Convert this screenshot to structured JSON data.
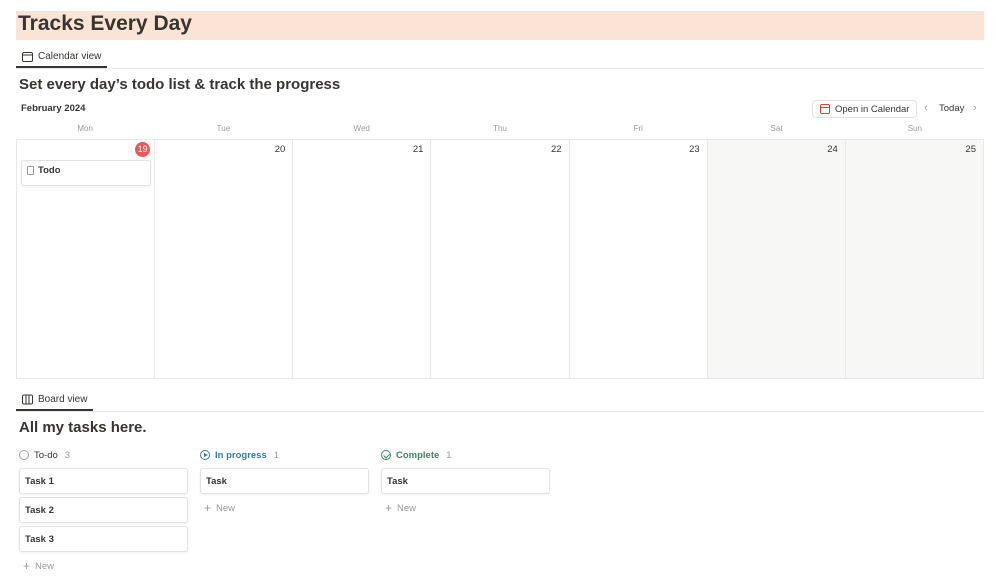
{
  "page": {
    "title": "Tracks Every Day"
  },
  "calendar_view": {
    "tab_label": "Calendar view",
    "heading": "Set every day’s todo list & track the progress",
    "month": "February 2024",
    "open_button": "Open in Calendar",
    "today_button": "Today",
    "weekdays": [
      "Mon",
      "Tue",
      "Wed",
      "Thu",
      "Fri",
      "Sat",
      "Sun"
    ],
    "days": [
      "19",
      "20",
      "21",
      "22",
      "23",
      "24",
      "25"
    ],
    "event": "Todo"
  },
  "board_view": {
    "tab_label": "Board view",
    "heading": "All my tasks here.",
    "new_label": "New",
    "columns": [
      {
        "label": "To-do",
        "count": "3",
        "cards": [
          "Task 1",
          "Task 2",
          "Task 3"
        ]
      },
      {
        "label": "In progress",
        "count": "1",
        "cards": [
          "Task"
        ]
      },
      {
        "label": "Complete",
        "count": "1",
        "cards": [
          "Task"
        ]
      }
    ]
  },
  "colors": {
    "title_banner": "#fbe4d5",
    "today_badge": "#eb5757",
    "in_progress": "#337ea9",
    "complete": "#448361"
  }
}
